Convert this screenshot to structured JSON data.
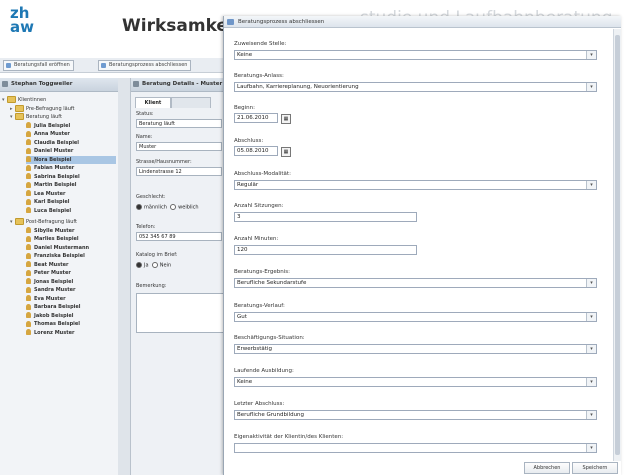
{
  "header": {
    "logo_line1": "zh",
    "logo_line2": "aw",
    "title": "Wirksamkeits",
    "title_faded": "studie und Laufbahnberatung"
  },
  "toolbar": {
    "btn1": "Beratungsfall eröffnen",
    "btn2": "Beratungsprozess abschliessen"
  },
  "tree": {
    "header": "Stephan Toggweiler",
    "root": "Klientinnen",
    "g1": "Pre-Befragung läuft",
    "g2": "Beratung läuft",
    "g3": "Post-Befragung läuft",
    "names_a": [
      "Julia Beispiel",
      "Anna Muster",
      "Claudia Beispiel",
      "Daniel Muster",
      "Nora Beispiel",
      "Fabian Muster",
      "Sabrina Beispiel",
      "Martin Beispiel",
      "Lea Muster",
      "Karl Beispiel",
      "Luca Beispiel"
    ],
    "names_b": [
      "Sibylle Muster",
      "Marlies Beispiel",
      "Daniel Mustermann",
      "Franziska Beispiel",
      "Beat Muster",
      "Peter Muster",
      "Jonas Beispiel",
      "Sandra Muster",
      "Eva Muster",
      "Barbara Beispiel",
      "Jakob Beispiel",
      "Thomas Beispiel",
      "Lorenz Muster"
    ]
  },
  "mid": {
    "header": "Beratung Details - Muster",
    "tab1": "Klient",
    "status_label": "Status:",
    "status_value": "Beratung läuft",
    "name_label": "Name:",
    "name_value": "Muster",
    "street_label": "Strasse/Hausnummer:",
    "street_value": "Lindenstrasse 12",
    "gender_label": "Geschlecht:",
    "gender_opt1": "männlich",
    "gender_opt2": "weiblich",
    "phone_label": "Telefon:",
    "phone_value": "052 345 67 89",
    "contact_label": "Katalog im Brief:",
    "contact_opt1": "Ja",
    "contact_opt2": "Nein",
    "remark_label": "Bemerkung:"
  },
  "dialog": {
    "title": "Beratungsprozess abschliessen",
    "f_stelle_label": "Zuweisende Stelle:",
    "f_stelle_value": "Keine",
    "f_anlass_label": "Beratungs-Anlass:",
    "f_anlass_value": "Laufbahn, Karriereplanung, Neuorientierung",
    "f_beginn_label": "Beginn:",
    "f_beginn_value": "21.06.2010",
    "f_abschluss_label": "Abschluss:",
    "f_abschluss_value": "05.08.2010",
    "f_modal_label": "Abschluss-Modalität:",
    "f_modal_value": "Regulär",
    "f_sitz_label": "Anzahl Sitzungen:",
    "f_sitz_value": "3",
    "f_min_label": "Anzahl Minuten:",
    "f_min_value": "120",
    "f_ergeb_label": "Beratungs-Ergebnis:",
    "f_ergeb_value": "Berufliche Sekundarstufe",
    "f_verlauf_label": "Beratungs-Verlauf:",
    "f_verlauf_value": "Gut",
    "f_situation_label": "Beschäftigungs-Situation:",
    "f_situation_value": "Erwerbstätig",
    "f_ausb_label": "Laufende Ausbildung:",
    "f_ausb_value": "Keine",
    "f_letzt_label": "Letzter Abschluss:",
    "f_letzt_value": "Berufliche Grundbildung",
    "f_eigen_label": "Eigenaktivität der Klientin/des Klienten:",
    "btn_cancel": "Abbrechen",
    "btn_save": "Speichern"
  }
}
